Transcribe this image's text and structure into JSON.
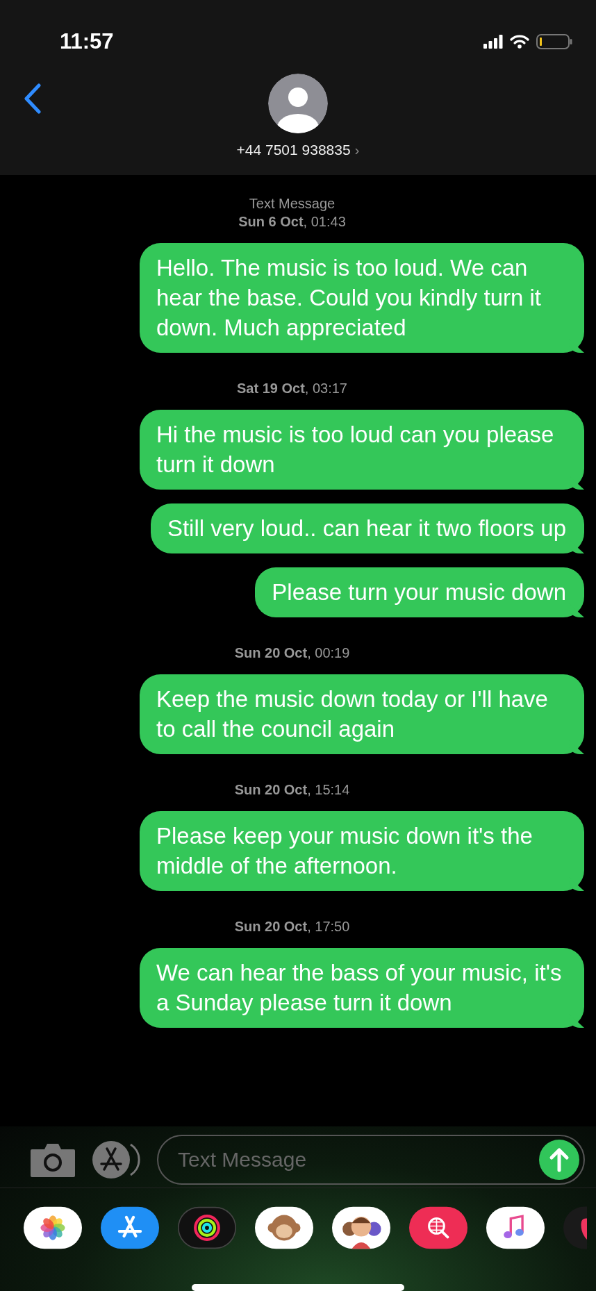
{
  "status_bar": {
    "time": "11:57"
  },
  "header": {
    "contact": "+44 7501 938835",
    "chevron": "›"
  },
  "thread": [
    {
      "kind": "timestamp",
      "text": "Text Message"
    },
    {
      "kind": "timestamp",
      "text": "**Sun 6 Oct**, 01:43"
    },
    {
      "kind": "message",
      "text": "Hello. The music is too loud. We can hear the base. Could you kindly turn it down. Much appreciated"
    },
    {
      "kind": "timestamp",
      "text": "**Sat 19 Oct**, 03:17"
    },
    {
      "kind": "message",
      "text": "Hi the music is too loud can you please turn it down"
    },
    {
      "kind": "message",
      "text": "Still very loud.. can hear it two floors up"
    },
    {
      "kind": "message",
      "text": "Please turn your music down"
    },
    {
      "kind": "timestamp",
      "text": "**Sun 20 Oct**, 00:19"
    },
    {
      "kind": "message",
      "text": "Keep the music down today or I'll have to call the council again"
    },
    {
      "kind": "timestamp",
      "text": "**Sun 20 Oct**, 15:14"
    },
    {
      "kind": "message",
      "text": "Please keep your music down it's the middle of the afternoon."
    },
    {
      "kind": "timestamp",
      "text": "**Sun 20 Oct**, 17:50"
    },
    {
      "kind": "message",
      "text": "We can hear the bass of your music, it's a Sunday please turn it down"
    }
  ],
  "composer": {
    "placeholder": "Text Message"
  },
  "dock": [
    {
      "kind": "photos"
    },
    {
      "kind": "appstore"
    },
    {
      "kind": "activity"
    },
    {
      "kind": "monkey"
    },
    {
      "kind": "memoji"
    },
    {
      "kind": "globe"
    },
    {
      "kind": "music"
    },
    {
      "kind": "heart"
    }
  ]
}
